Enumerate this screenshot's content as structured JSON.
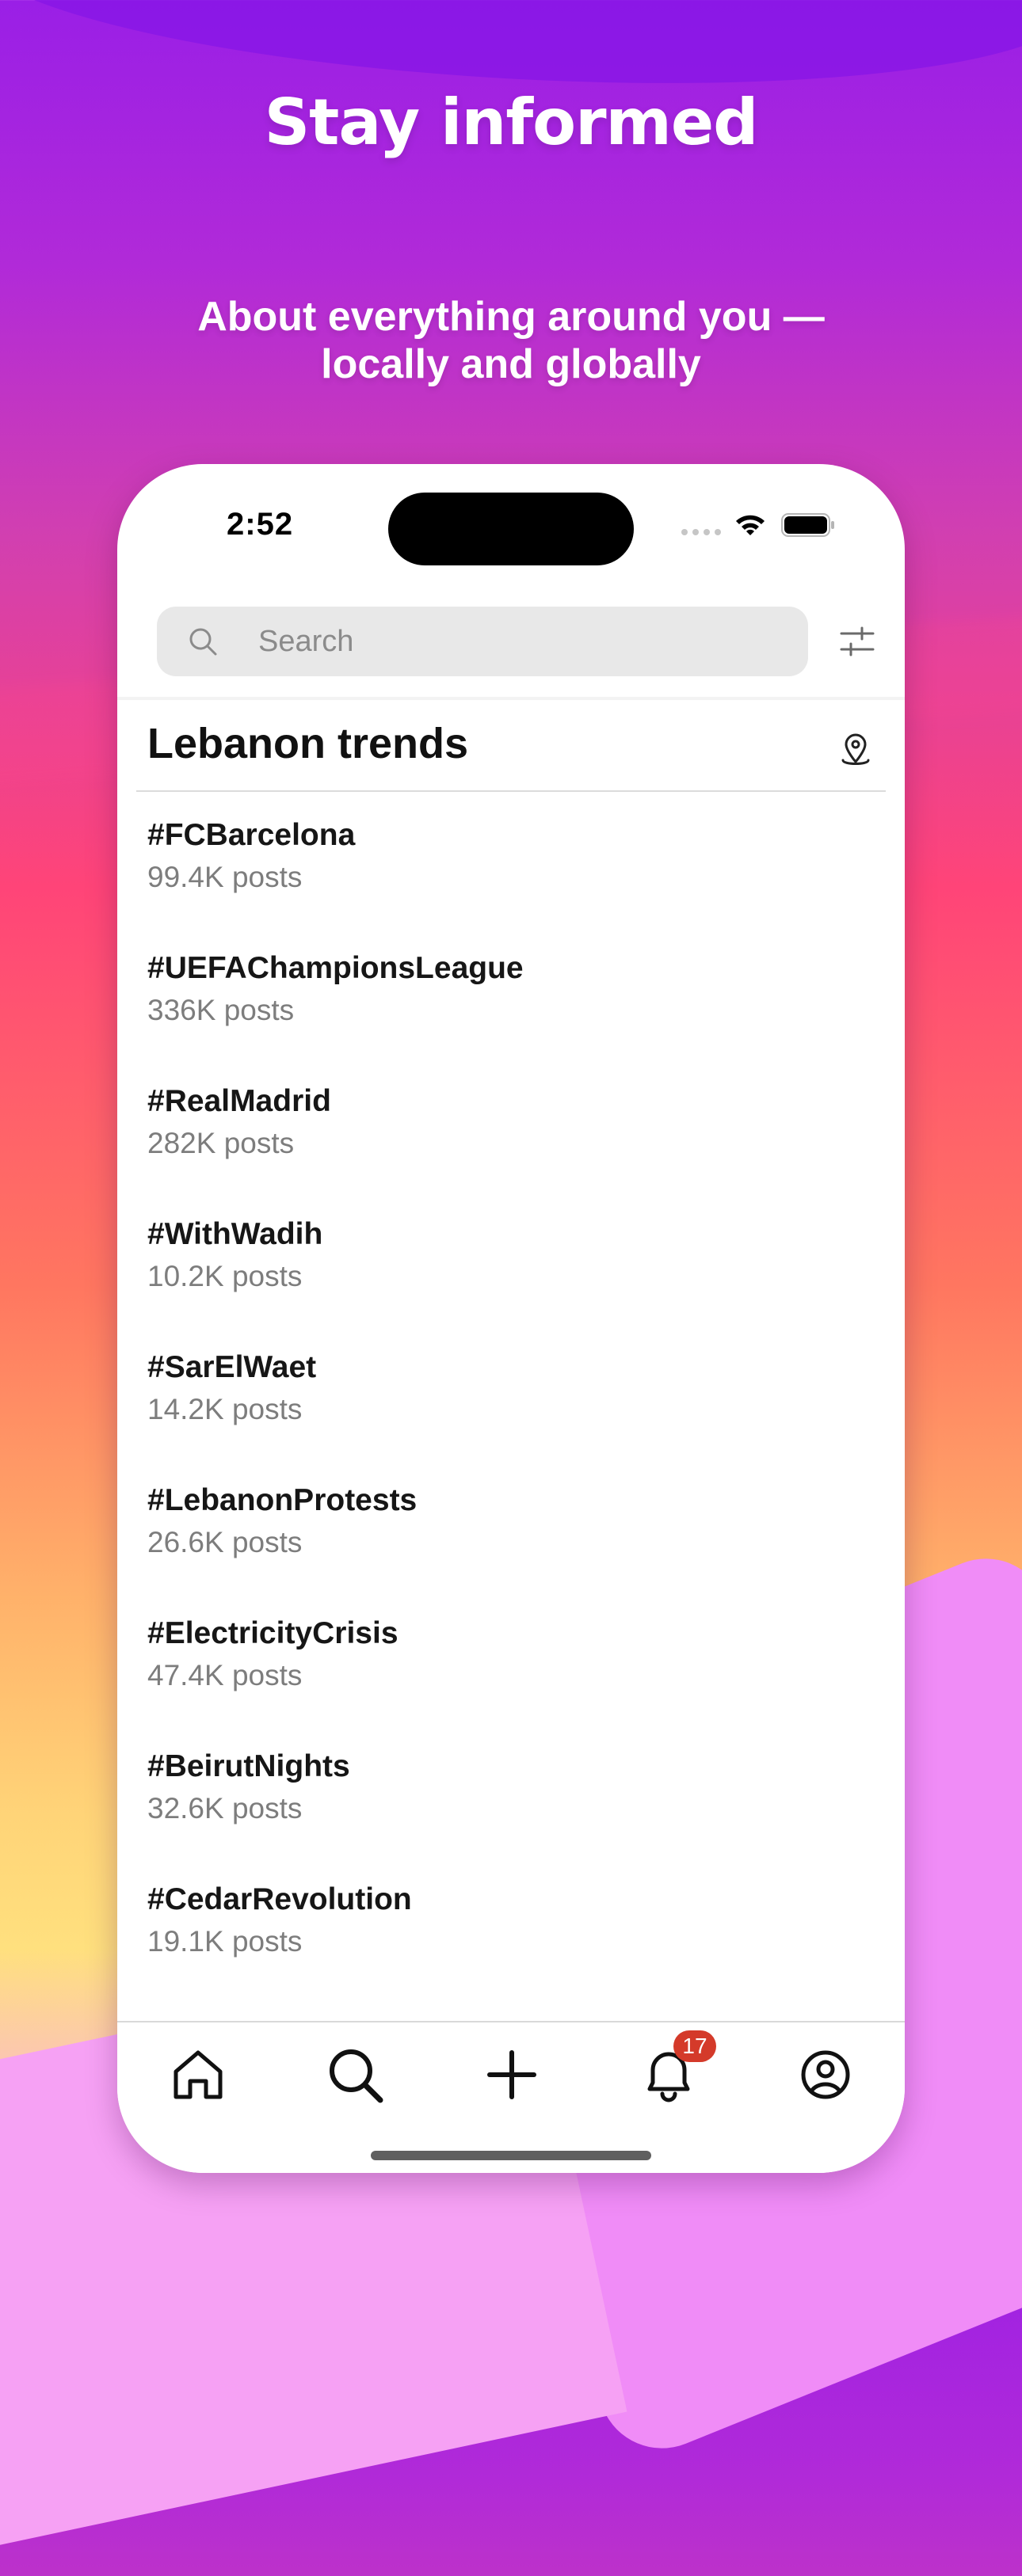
{
  "promo": {
    "title": "Stay informed",
    "subtitle": "About everything around you — locally and globally"
  },
  "status_bar": {
    "time": "2:52"
  },
  "search": {
    "placeholder": "Search"
  },
  "trends": {
    "title": "Lebanon trends",
    "items": [
      {
        "tag": "#FCBarcelona",
        "count": "99.4K posts"
      },
      {
        "tag": "#UEFAChampionsLeague",
        "count": "336K posts"
      },
      {
        "tag": "#RealMadrid",
        "count": "282K posts"
      },
      {
        "tag": "#WithWadih",
        "count": "10.2K posts"
      },
      {
        "tag": "#SarElWaet",
        "count": "14.2K posts"
      },
      {
        "tag": "#LebanonProtests",
        "count": "26.6K posts"
      },
      {
        "tag": "#ElectricityCrisis",
        "count": "47.4K posts"
      },
      {
        "tag": "#BeirutNights",
        "count": "32.6K posts"
      },
      {
        "tag": "#CedarRevolution",
        "count": "19.1K posts"
      }
    ]
  },
  "tab_bar": {
    "tabs": [
      {
        "icon": "home-icon"
      },
      {
        "icon": "search-icon"
      },
      {
        "icon": "plus-icon"
      },
      {
        "icon": "bell-icon"
      },
      {
        "icon": "profile-icon"
      }
    ],
    "notification_badge": "17"
  },
  "colors": {
    "accent_badge": "#d43a2a",
    "text_primary": "#161616",
    "text_secondary": "#7d7d7d",
    "background_top": "#9a1fe6",
    "background_mid": "#ff4478",
    "background_bottom": "#ffe07e"
  }
}
